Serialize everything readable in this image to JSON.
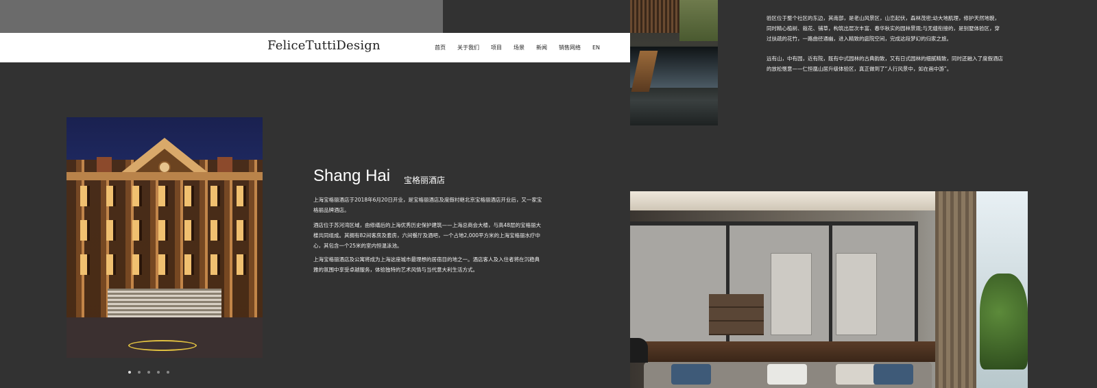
{
  "header": {
    "logo": "FeliceTuttiDesign",
    "nav": [
      "首页",
      "关于我们",
      "项目",
      "场景",
      "新闻",
      "销售网络",
      "EN"
    ]
  },
  "hotel": {
    "city": "Shang Hai",
    "name": "宝格丽酒店",
    "paragraphs": [
      "上海宝格丽酒店于2018年6月20日开业，是宝格丽酒店及度假村继北京宝格丽酒店开业后，又一家宝格丽品牌酒店。",
      "酒店位于苏河湾区域，由修缮后的上海优秀历史保护建筑——上海总商会大楼，与高48层的宝格丽大楼共同组成。其拥有82间客房及套房，六间餐厅及酒吧，一个占地2,000平方米的上海宝格丽水疗中心，其包含一个25米的室内恒温泳池。",
      "上海宝格丽酒店及公寓将成为上海这座城市最理想的居宿目的地之一。酒店客人及入住者将在沉稳典雅的氛围中享受卓越服务，体验独特的艺术风情与当代意大利生活方式。"
    ]
  },
  "garden": {
    "paragraphs": [
      "验区位于整个社区的东边，其南部，是老山风景区，山峦起伏，森林茂密;幼大地肌理，修护天然地貌，同时精心植树、栽花、铺草，构筑出层次丰富、春华秋实的园林景观;与无缝衔接的，是别墅体验区，穿过扶疏的花竹，一路曲径通幽，进入精致的庭院空间，完成这段梦幻的归家之旅。",
      "远有山，中有园，近有院，既有中式园林的古典韵致，又有日式园林的细腻精致，同时还融入了度假酒店的放松惬意——仁恒凰山居升级体验区，真正做到了“人行风景中，如在画中游”。"
    ]
  },
  "carousel": {
    "dots": 5,
    "active_index": 0
  },
  "colors": {
    "page_bg": "#323232",
    "header_bg": "#ffffff",
    "top_band": "#6b6b6b",
    "text": "#ffffff"
  }
}
